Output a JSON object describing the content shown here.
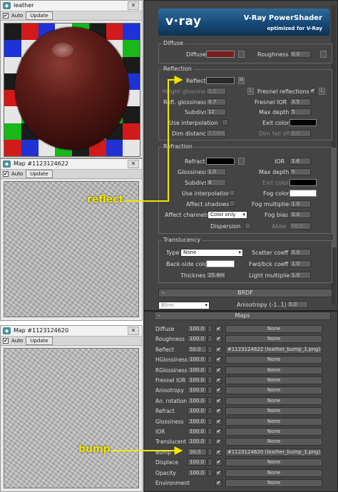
{
  "preview_windows": [
    {
      "title": "leather",
      "auto_label": "Auto",
      "update_label": "Update"
    },
    {
      "title": "Map #1123124622",
      "auto_label": "Auto",
      "update_label": "Update"
    },
    {
      "title": "Map #1123124620",
      "auto_label": "Auto",
      "update_label": "Update"
    }
  ],
  "banner": {
    "logo": "v·ray",
    "title": "V-Ray PowerShader",
    "subtitle": "optimized for V-Ray"
  },
  "diffuse": {
    "group_title": "Diffuse",
    "diffuse_label": "Diffuse",
    "diffuse_color": "#7a1f1f",
    "roughness_label": "Roughness",
    "roughness_value": "0.0"
  },
  "reflection": {
    "group_title": "Reflection",
    "reflect_label": "Reflect",
    "reflect_color": "#2a2a2a",
    "m_label": "M",
    "hilight_label": "Hilight glossiness",
    "hilight_value": "1.0",
    "l_label": "L",
    "fresnel_label": "Fresnel reflections",
    "fresnel_l": "L",
    "refl_gloss_label": "Refl. glossiness",
    "refl_gloss_value": "0.7",
    "fresnel_ior_label": "Fresnel IOR",
    "fresnel_ior_value": "3.5",
    "subdivs_label": "Subdivs",
    "subdivs_value": "12",
    "max_depth_label": "Max depth",
    "max_depth_value": "5",
    "use_interp_label": "Use interpolation",
    "exit_color_label": "Exit color",
    "exit_color": "#000000",
    "dim_dist_label": "Dim distance",
    "dim_dist_value": "2.54m",
    "dim_falloff_label": "Dim fall off",
    "dim_falloff_value": "0.0"
  },
  "refraction": {
    "group_title": "Refraction",
    "refract_label": "Refract",
    "refract_color": "#000000",
    "ior_label": "IOR",
    "ior_value": "1.6",
    "glossiness_label": "Glossiness",
    "glossiness_value": "1.0",
    "max_depth_label": "Max depth",
    "max_depth_value": "5",
    "subdivs_label": "Subdivs",
    "subdivs_value": "8",
    "exit_color_label": "Exit color",
    "use_interp_label": "Use interpolation",
    "fog_color_label": "Fog color",
    "fog_color": "#ffffff",
    "affect_shadows_label": "Affect shadows",
    "fog_mult_label": "Fog multiplier",
    "fog_mult_value": "1.0",
    "affect_channels_label": "Affect channels",
    "affect_channels_value": "Color only",
    "fog_bias_label": "Fog bias",
    "fog_bias_value": "0.0",
    "dispersion_label": "Dispersion",
    "abbe_label": "Abbe",
    "abbe_value": "50.0"
  },
  "translucency": {
    "group_title": "Translucency",
    "type_label": "Type",
    "type_value": "None",
    "scatter_label": "Scatter coeff",
    "scatter_value": "0.0",
    "back_side_label": "Back-side color",
    "back_side_color": "#ffffff",
    "fwd_bck_label": "Fwd/bck coeff",
    "fwd_bck_value": "1.0",
    "thickness_label": "Thickness",
    "thickness_value": "25.4m",
    "light_mult_label": "Light multiplier",
    "light_mult_value": "1.0"
  },
  "brdf": {
    "rollout_title": "BRDF",
    "type_value": "Blinn",
    "anisotropy_label": "Anisotropy (-1..1)",
    "anisotropy_value": "0.0"
  },
  "maps": {
    "rollout_title": "Maps",
    "rows": [
      {
        "name": "Diffuse",
        "amount": "100.0",
        "map": "None"
      },
      {
        "name": "Roughness",
        "amount": "100.0",
        "map": "None"
      },
      {
        "name": "Reflect",
        "amount": "50.0",
        "map": "#1123124622 (leather_bump_1.png)"
      },
      {
        "name": "HGlossiness",
        "amount": "100.0",
        "map": "None"
      },
      {
        "name": "RGlossiness",
        "amount": "100.0",
        "map": "None"
      },
      {
        "name": "Fresnel IOR",
        "amount": "100.0",
        "map": "None"
      },
      {
        "name": "Anisotropy",
        "amount": "100.0",
        "map": "None"
      },
      {
        "name": "An. rotation",
        "amount": "100.0",
        "map": "None"
      },
      {
        "name": "Refract",
        "amount": "100.0",
        "map": "None"
      },
      {
        "name": "Glossiness",
        "amount": "100.0",
        "map": "None"
      },
      {
        "name": "IOR",
        "amount": "100.0",
        "map": "None"
      },
      {
        "name": "Translucent",
        "amount": "100.0",
        "map": "None"
      },
      {
        "name": "Bump",
        "amount": "30.0",
        "map": "#1123124620 (leather_bump_1.png)"
      },
      {
        "name": "Displace",
        "amount": "100.0",
        "map": "None"
      },
      {
        "name": "Opacity",
        "amount": "100.0",
        "map": "None"
      },
      {
        "name": "Environment",
        "amount": "",
        "map": "None"
      }
    ]
  },
  "annotations": {
    "reflect": "reflect",
    "bump": "bump"
  }
}
